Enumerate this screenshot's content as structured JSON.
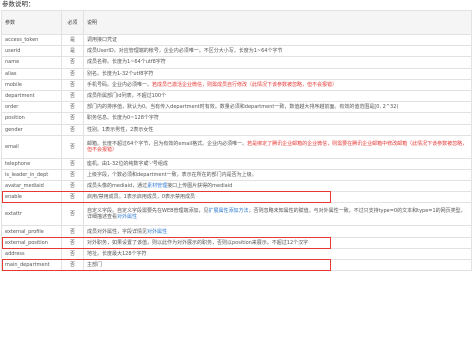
{
  "title": "参数说明：",
  "headers": {
    "param": "参数",
    "required": "必须",
    "desc": "说明"
  },
  "rows": [
    {
      "param": "access_token",
      "required": "是",
      "desc": [
        {
          "t": "调用接口凭证"
        }
      ]
    },
    {
      "param": "userid",
      "required": "是",
      "desc": [
        {
          "t": "成员UserID。对应管理端的帐号，企业内必须唯一。不区分大小写，长度为1~64个字节"
        }
      ]
    },
    {
      "param": "name",
      "required": "否",
      "desc": [
        {
          "t": "成员名称。长度为1~64个utf8字符"
        }
      ]
    },
    {
      "param": "alias",
      "required": "否",
      "desc": [
        {
          "t": "别名。长度为1-32个utf8字符"
        }
      ]
    },
    {
      "param": "mobile",
      "required": "否",
      "desc": [
        {
          "t": "手机号码。企业内必须唯一。"
        },
        {
          "t": "若成员已激活企业微信，则需成员自行修改（此情况下该参数被忽略，但不会报错）",
          "c": "red"
        }
      ]
    },
    {
      "param": "department",
      "required": "否",
      "desc": [
        {
          "t": "成员所属部门id列表，不超过100个"
        }
      ]
    },
    {
      "param": "order",
      "required": "否",
      "desc": [
        {
          "t": "部门内的排序值，默认为0。当有传入department时有效。数量必须和department一致，数值越大排序越前面。有效的值范围是[0, 2^32)"
        }
      ]
    },
    {
      "param": "position",
      "required": "否",
      "desc": [
        {
          "t": "职务信息。长度为0~128个字符"
        }
      ]
    },
    {
      "param": "gender",
      "required": "否",
      "desc": [
        {
          "t": "性别。1表示男性，2表示女性"
        }
      ]
    },
    {
      "param": "email",
      "required": "否",
      "desc": [
        {
          "t": "邮箱。长度不超过64个字节，且为有效的email格式。企业内必须唯一。"
        },
        {
          "t": "若是绑定了腾讯企业邮箱的企业微信，则需要在腾讯企业邮箱中修改邮箱（此情况下该参数被忽略，但不会报错）",
          "c": "red"
        }
      ],
      "tall": true
    },
    {
      "param": "telephone",
      "required": "否",
      "desc": [
        {
          "t": "座机。由1-32位的纯数字或'-'号组成"
        }
      ]
    },
    {
      "param": "is_leader_in_dept",
      "required": "否",
      "desc": [
        {
          "t": "上级字段，个数必须和department一致，表示在所在的部门内是否为上级。"
        }
      ]
    },
    {
      "param": "avatar_mediaid",
      "required": "否",
      "desc": [
        {
          "t": "成员头像的mediaid，通过"
        },
        {
          "t": "素材管理",
          "c": "link"
        },
        {
          "t": "接口上传图片获得的mediaid"
        }
      ]
    },
    {
      "param": "enable",
      "required": "否",
      "desc": [
        {
          "t": "启用/禁用成员。1表示启用成员，0表示禁用成员"
        }
      ],
      "highlight": true
    },
    {
      "param": "extattr",
      "required": "否",
      "desc": [
        {
          "t": "自定义字段。自定义字段需要先在WEB管理端添加，见"
        },
        {
          "t": "扩展属性添加方法",
          "c": "link"
        },
        {
          "t": "，否则忽略未知属性的赋值。与对外属性一致，不过只支持type=0的文本和type=1的网页类型，详细描述查看"
        },
        {
          "t": "对外属性",
          "c": "link"
        }
      ],
      "tall": true
    },
    {
      "param": "external_profile",
      "required": "否",
      "desc": [
        {
          "t": "成员对外属性，字段详情见"
        },
        {
          "t": "对外属性",
          "c": "link"
        }
      ]
    },
    {
      "param": "external_position",
      "required": "否",
      "desc": [
        {
          "t": "对外职务，如果设置了该值，则以此作为对外展示的职务，否则以position来展示。不超过12个汉字"
        }
      ],
      "highlight": true
    },
    {
      "param": "address",
      "required": "否",
      "desc": [
        {
          "t": "地址。长度最大128个字符"
        }
      ]
    },
    {
      "param": "main_department",
      "required": "否",
      "desc": [
        {
          "t": "主部门"
        }
      ],
      "highlight": true
    }
  ]
}
